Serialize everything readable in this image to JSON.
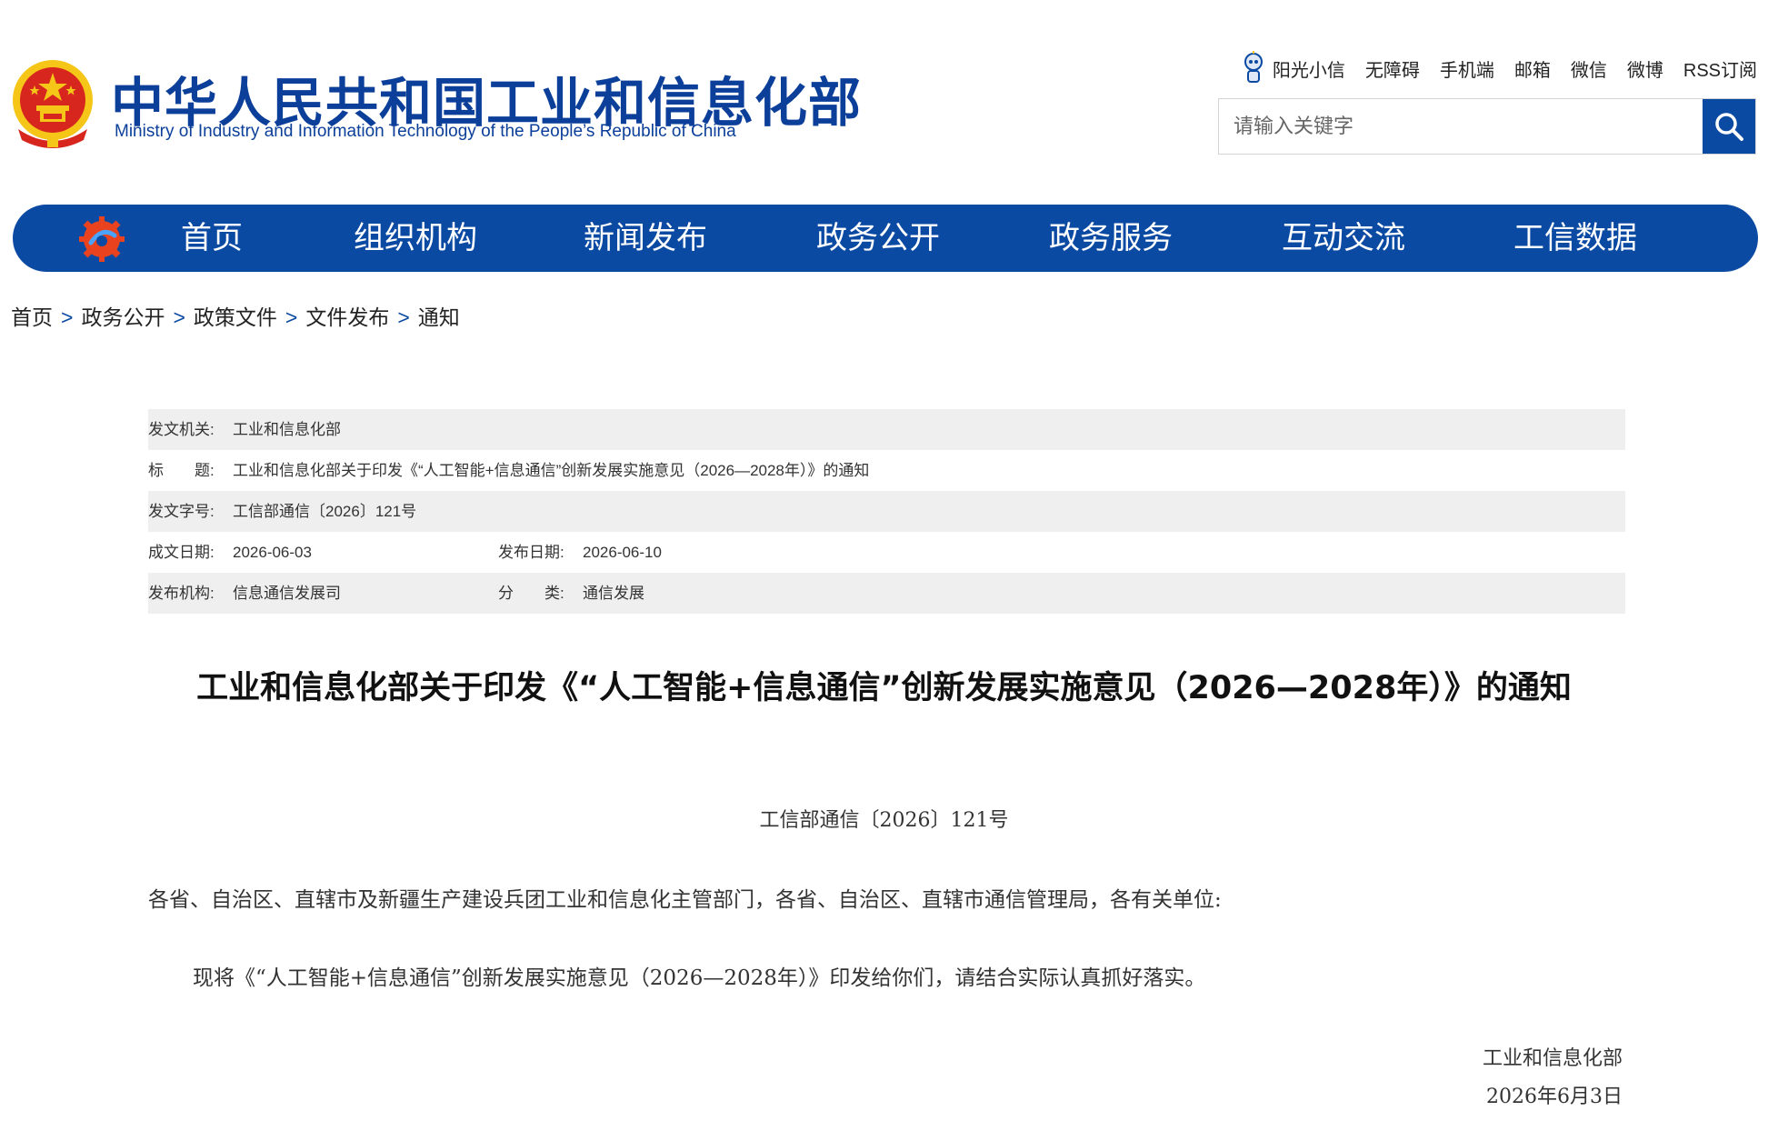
{
  "header": {
    "title_cn": "中华人民共和国工业和信息化部",
    "title_en": "Ministry of Industry and Information Technology of the People’s Republic of China",
    "emblem_icon": "national-emblem-icon",
    "top_links": [
      "阳光小信",
      "无障碍",
      "手机端",
      "邮箱",
      "微信",
      "微博",
      "RSS订阅"
    ],
    "search": {
      "placeholder": "请输入关键字",
      "icon": "search-icon"
    }
  },
  "nav": {
    "logo_icon": "gear-logo-icon",
    "items": [
      "首页",
      "组织机构",
      "新闻发布",
      "政务公开",
      "政务服务",
      "互动交流",
      "工信数据"
    ]
  },
  "breadcrumb": {
    "items": [
      "首页",
      "政务公开",
      "政策文件",
      "文件发布",
      "通知"
    ],
    "separator": ">"
  },
  "meta": {
    "issuer_label": "发文机关:",
    "issuer": "工业和信息化部",
    "title_label": "标　　题:",
    "title": "工业和信息化部关于印发《“人工智能+信息通信”创新发展实施意见（2026—2028年）》的通知",
    "doc_no_label": "发文字号:",
    "doc_no": "工信部通信〔2026〕121号",
    "written_label": "成文日期:",
    "written_date": "2026-06-03",
    "publish_label": "发布日期:",
    "publish_date": "2026-06-10",
    "org_label": "发布机构:",
    "org": "信息通信发展司",
    "category_label": "分　　类:",
    "category": "通信发展"
  },
  "article": {
    "title": "工业和信息化部关于印发《“人工智能+信息通信”创新发展实施意见（2026—2028年）》的通知",
    "doc_number": "工信部通信〔2026〕121号",
    "salutation": "各省、自治区、直辖市及新疆生产建设兵团工业和信息化主管部门，各省、自治区、直辖市通信管理局，各有关单位:",
    "body": "现将《“人工智能+信息通信”创新发展实施意见（2026—2028年）》印发给你们，请结合实际认真抓好落实。",
    "signer": "工业和信息化部",
    "sign_date": "2026年6月3日"
  },
  "colors": {
    "brand_blue": "#0b4aa2",
    "title_blue": "#0b3f99",
    "meta_shade": "#efefef",
    "emblem_red": "#d7261e",
    "emblem_gold": "#f5c518"
  }
}
